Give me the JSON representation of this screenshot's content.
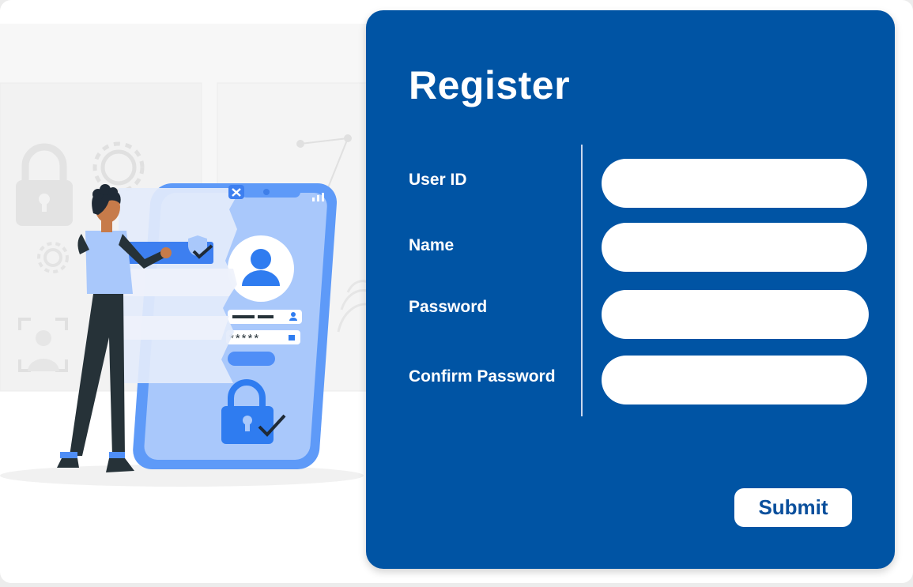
{
  "form": {
    "title": "Register",
    "fields": [
      {
        "label": "User ID",
        "value": ""
      },
      {
        "label": "Name",
        "value": ""
      },
      {
        "label": "Password",
        "value": ""
      },
      {
        "label": "Confirm Password",
        "value": ""
      }
    ],
    "submit_label": "Submit"
  },
  "illustration": {
    "password_mask": "*****"
  },
  "colors": {
    "panel": "#0054a4",
    "accent_blue": "#4f8ef7",
    "light_blue": "#a9c8fb"
  }
}
